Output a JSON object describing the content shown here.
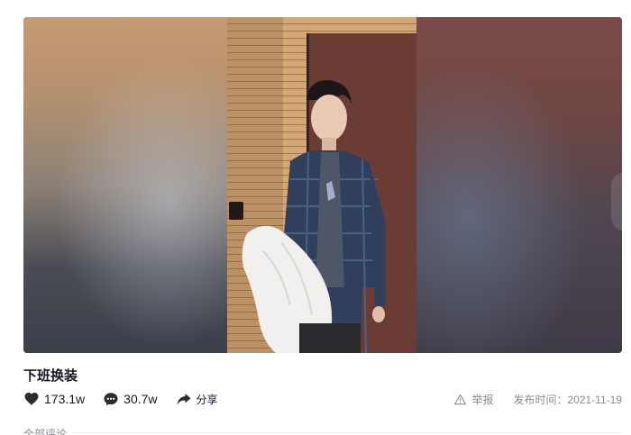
{
  "video": {
    "title": "下班换装",
    "scroll_up_icon": "chevron-up-icon",
    "scroll_down_icon": "chevron-down-icon"
  },
  "actions": {
    "likes": "173.1w",
    "comments": "30.7w",
    "share_label": "分享"
  },
  "meta": {
    "report_label": "举报",
    "publish_time": "发布时间：2021-11-19"
  },
  "comments_section": {
    "heading": "全部评论"
  },
  "colors": {
    "text": "#161823",
    "muted": "#8a8b91",
    "door": "#6a3c33",
    "wall": "#d4a876"
  }
}
